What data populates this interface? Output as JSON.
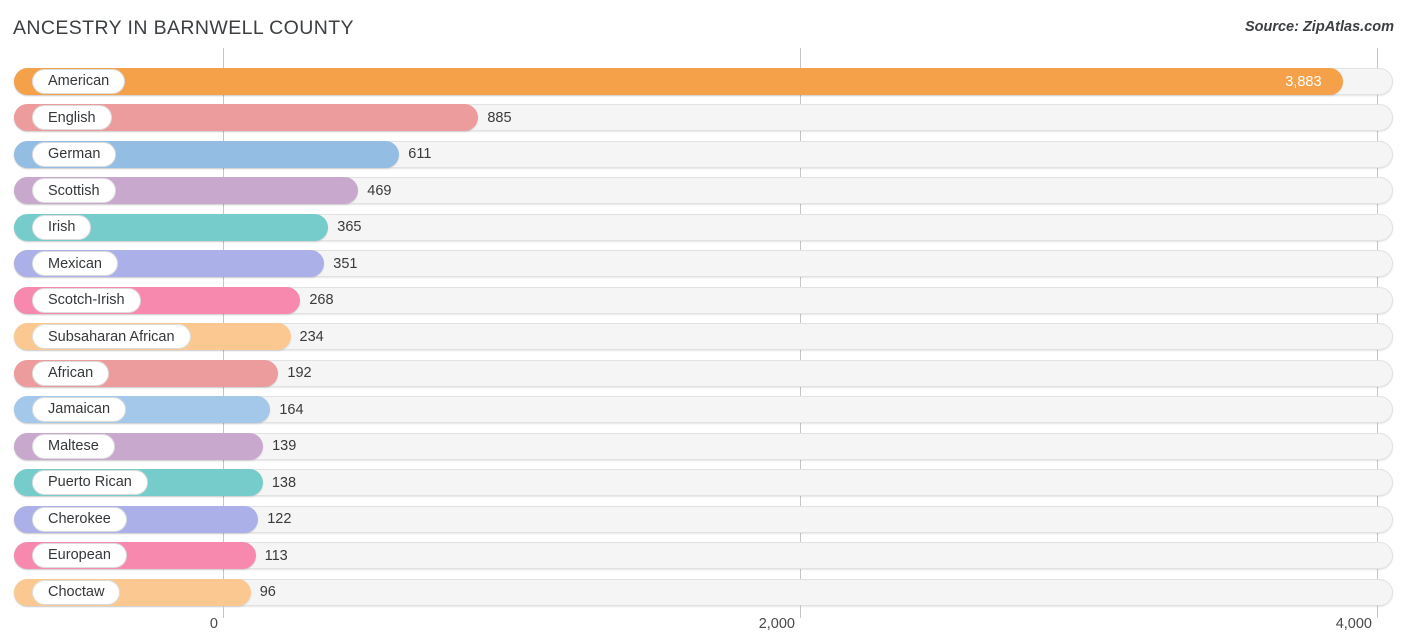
{
  "header": {
    "title": "ANCESTRY IN BARNWELL COUNTY",
    "source": "Source: ZipAtlas.com"
  },
  "chart_data": {
    "type": "bar",
    "orientation": "horizontal",
    "title": "ANCESTRY IN BARNWELL COUNTY",
    "xlabel": "",
    "ylabel": "",
    "xlim": [
      0,
      4000
    ],
    "grid": true,
    "legend": "none",
    "x_ticks": [
      {
        "value": 0,
        "label": "0"
      },
      {
        "value": 2000,
        "label": "2,000"
      },
      {
        "value": 4000,
        "label": "4,000"
      }
    ],
    "categories": [
      "American",
      "English",
      "German",
      "Scottish",
      "Irish",
      "Mexican",
      "Scotch-Irish",
      "Subsaharan African",
      "African",
      "Jamaican",
      "Maltese",
      "Puerto Rican",
      "Cherokee",
      "European",
      "Choctaw"
    ],
    "values": [
      3883,
      885,
      611,
      469,
      365,
      351,
      268,
      234,
      192,
      164,
      139,
      138,
      122,
      113,
      96
    ],
    "value_labels": [
      "3,883",
      "885",
      "611",
      "469",
      "365",
      "351",
      "268",
      "234",
      "192",
      "164",
      "139",
      "138",
      "122",
      "113",
      "96"
    ],
    "bars": [
      {
        "label": "American",
        "value": 3883,
        "value_label": "3,883",
        "color": "#F4A14A",
        "label_inside": true
      },
      {
        "label": "English",
        "value": 885,
        "value_label": "885",
        "color": "#EC9C9C",
        "label_inside": false
      },
      {
        "label": "German",
        "value": 611,
        "value_label": "611",
        "color": "#93BDE3",
        "label_inside": false
      },
      {
        "label": "Scottish",
        "value": 469,
        "value_label": "469",
        "color": "#C9A8CE",
        "label_inside": false
      },
      {
        "label": "Irish",
        "value": 365,
        "value_label": "365",
        "color": "#76CCCB",
        "label_inside": false
      },
      {
        "label": "Mexican",
        "value": 351,
        "value_label": "351",
        "color": "#ABB0E8",
        "label_inside": false
      },
      {
        "label": "Scotch-Irish",
        "value": 268,
        "value_label": "268",
        "color": "#F789AE",
        "label_inside": false
      },
      {
        "label": "Subsaharan African",
        "value": 234,
        "value_label": "234",
        "color": "#FBC891",
        "label_inside": false
      },
      {
        "label": "African",
        "value": 192,
        "value_label": "192",
        "color": "#EC9C9C",
        "label_inside": false
      },
      {
        "label": "Jamaican",
        "value": 164,
        "value_label": "164",
        "color": "#A4C8EA",
        "label_inside": false
      },
      {
        "label": "Maltese",
        "value": 139,
        "value_label": "139",
        "color": "#C9A8CE",
        "label_inside": false
      },
      {
        "label": "Puerto Rican",
        "value": 138,
        "value_label": "138",
        "color": "#76CCCB",
        "label_inside": false
      },
      {
        "label": "Cherokee",
        "value": 122,
        "value_label": "122",
        "color": "#ABB0E8",
        "label_inside": false
      },
      {
        "label": "European",
        "value": 113,
        "value_label": "113",
        "color": "#F789AE",
        "label_inside": false
      },
      {
        "label": "Choctaw",
        "value": 96,
        "value_label": "96",
        "color": "#FBC891",
        "label_inside": false
      }
    ],
    "colors": {
      "orange": "#F4A14A",
      "salmon": "#EC9C9C",
      "blue": "#93BDE3",
      "purple": "#C9A8CE",
      "teal": "#76CCCB",
      "periwinkle": "#ABB0E8",
      "pink": "#F789AE",
      "peach": "#FBC891",
      "track": "#F5F5F5",
      "gridline": "#C6C6C6",
      "text": "#3C4043"
    }
  }
}
